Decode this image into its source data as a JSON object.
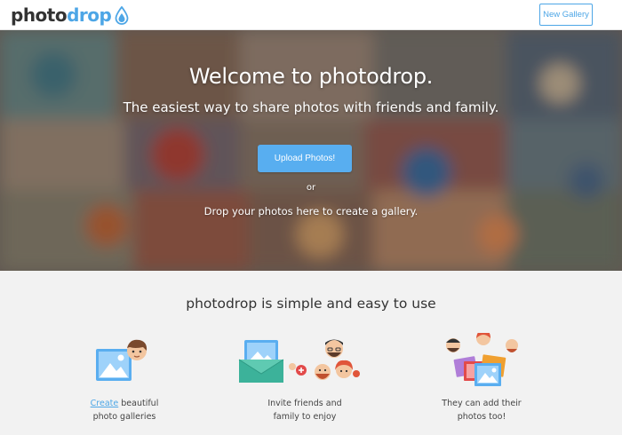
{
  "header": {
    "logo_part1": "photo",
    "logo_part2": "drop",
    "logo_icon": "water-drop-icon",
    "new_gallery_label": "New Gallery"
  },
  "hero": {
    "title": "Welcome to photodrop.",
    "subtitle": "The easiest way to share photos with friends and family.",
    "upload_label": "Upload Photos!",
    "or_text": "or",
    "drop_text": "Drop your photos here to create a gallery."
  },
  "features": {
    "title": "photodrop is simple and easy to use",
    "items": [
      {
        "icon": "photo-gallery-person-icon",
        "link": "Create",
        "line1_rest": " beautiful",
        "line2": "photo galleries"
      },
      {
        "icon": "invite-envelope-people-icon",
        "line1": "Invite friends and",
        "line2": "family to enjoy"
      },
      {
        "icon": "people-add-photos-icon",
        "line1": "They can add their",
        "line2": "photos too!"
      }
    ]
  },
  "colors": {
    "accent": "#4da6e6",
    "button": "#58aef0",
    "features_bg": "#f2f2f2"
  }
}
